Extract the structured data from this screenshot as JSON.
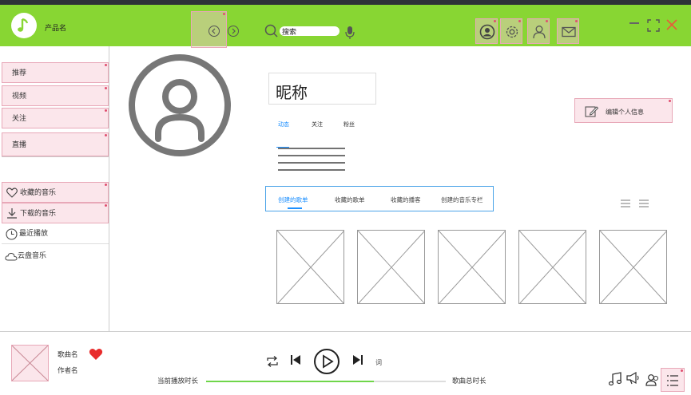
{
  "header": {
    "product_name": "产品名",
    "search_value": "搜索"
  },
  "sidebar": {
    "items": [
      {
        "label": "推荐"
      },
      {
        "label": "视频"
      },
      {
        "label": "关注"
      },
      {
        "label": "直播"
      }
    ],
    "my_music": [
      {
        "label": "收藏的音乐",
        "icon": "heart-outline-icon"
      },
      {
        "label": "下载的音乐",
        "icon": "download-icon"
      },
      {
        "label": "最近播放",
        "icon": "clock-icon"
      },
      {
        "label": "云盘音乐",
        "icon": "cloud-icon"
      }
    ]
  },
  "profile": {
    "nickname": "昵称",
    "edit_button": "编辑个人信息",
    "stat_tabs": [
      "动态",
      "关注",
      "粉丝"
    ]
  },
  "list_tabs": [
    "创建的歌单",
    "收藏的歌单",
    "收藏的播客",
    "创建的音乐专栏"
  ],
  "player": {
    "song_name": "歌曲名",
    "artist_name": "作者名",
    "lyric_label": "词",
    "current_time_label": "当前播放时长",
    "total_time_label": "歌曲总时长",
    "progress": 0.7
  },
  "colors": {
    "header_bg": "#88d633",
    "accent_blue": "#1e90ff",
    "heart_red": "#e82c2c",
    "progress_green": "#6fd64a"
  }
}
